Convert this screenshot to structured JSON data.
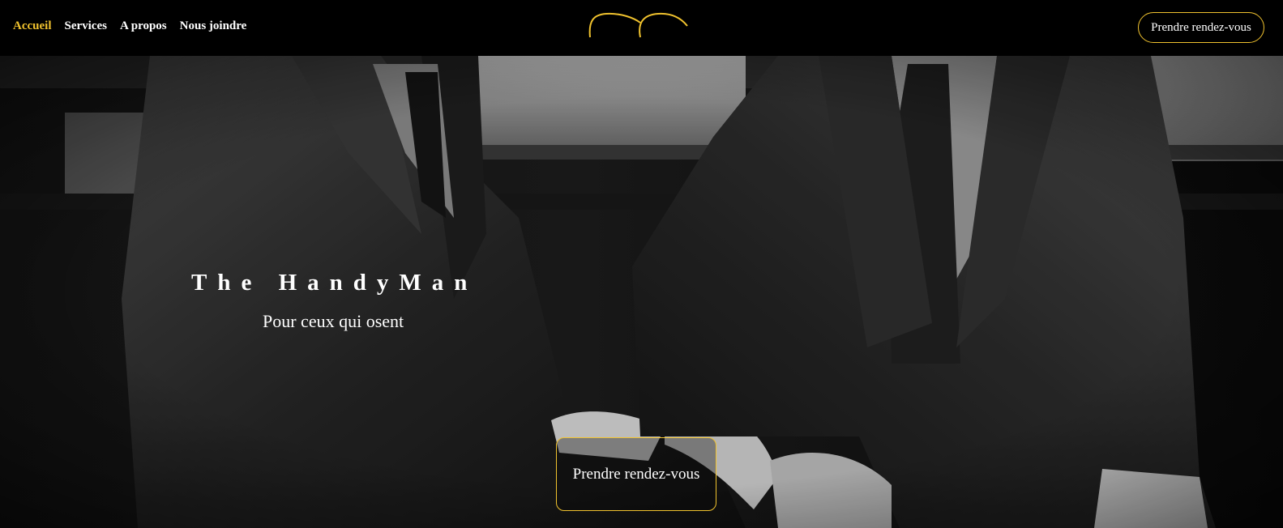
{
  "nav": {
    "links": [
      {
        "label": "Accueil",
        "active": true
      },
      {
        "label": "Services",
        "active": false
      },
      {
        "label": "A propos",
        "active": false
      },
      {
        "label": "Nous joindre",
        "active": false
      }
    ],
    "cta_label": "Prendre rendez-vous"
  },
  "hero": {
    "title": "The HandyMan",
    "subtitle": "Pour ceux qui osent",
    "cta_label": "Prendre rendez-vous",
    "photo": "black-and-white photo of two men in dark suits and ties seated"
  },
  "colors": {
    "accent": "#f0c22e",
    "background": "#000000",
    "text": "#ffffff"
  }
}
